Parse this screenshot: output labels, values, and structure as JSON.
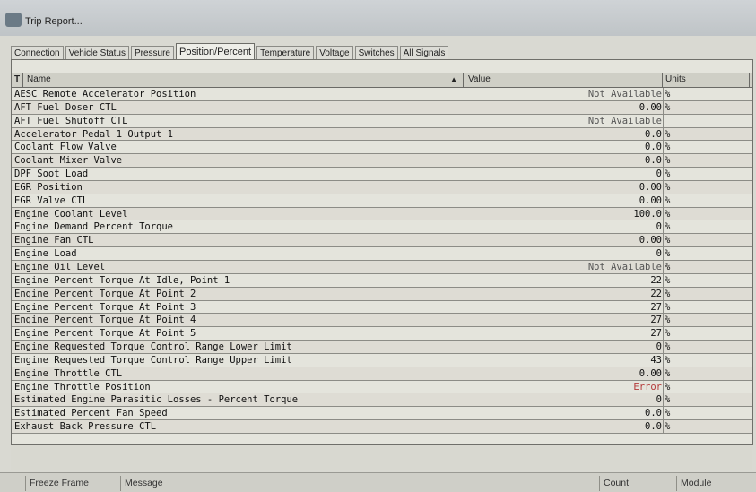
{
  "window": {
    "title": "Trip Report..."
  },
  "tabs": [
    {
      "label": "Connection",
      "active": false
    },
    {
      "label": "Vehicle Status",
      "active": false
    },
    {
      "label": "Pressure",
      "active": false
    },
    {
      "label": "Position/Percent",
      "active": true
    },
    {
      "label": "Temperature",
      "active": false
    },
    {
      "label": "Voltage",
      "active": false
    },
    {
      "label": "Switches",
      "active": false
    },
    {
      "label": "All Signals",
      "active": false
    }
  ],
  "table": {
    "filter_glyph": "T",
    "columns": {
      "name": "Name",
      "sort_glyph": "▲",
      "value": "Value",
      "units": "Units"
    },
    "rows": [
      {
        "name": "AESC Remote Accelerator Position",
        "value": "Not Available",
        "units": "%"
      },
      {
        "name": "AFT Fuel Doser CTL",
        "value": "0.00",
        "units": "%"
      },
      {
        "name": "AFT Fuel Shutoff CTL",
        "value": "Not Available",
        "units": ""
      },
      {
        "name": "Accelerator Pedal 1 Output 1",
        "value": "0.0",
        "units": "%"
      },
      {
        "name": "Coolant Flow Valve",
        "value": "0.0",
        "units": "%"
      },
      {
        "name": "Coolant Mixer Valve",
        "value": "0.0",
        "units": "%"
      },
      {
        "name": "DPF Soot Load",
        "value": "0",
        "units": "%"
      },
      {
        "name": "EGR Position",
        "value": "0.00",
        "units": "%"
      },
      {
        "name": "EGR Valve CTL",
        "value": "0.00",
        "units": "%"
      },
      {
        "name": "Engine Coolant Level",
        "value": "100.0",
        "units": "%"
      },
      {
        "name": "Engine Demand Percent Torque",
        "value": "0",
        "units": "%"
      },
      {
        "name": "Engine Fan CTL",
        "value": "0.00",
        "units": "%"
      },
      {
        "name": "Engine Load",
        "value": "0",
        "units": "%"
      },
      {
        "name": "Engine Oil Level",
        "value": "Not Available",
        "units": "%"
      },
      {
        "name": "Engine Percent Torque At Idle, Point 1",
        "value": "22",
        "units": "%"
      },
      {
        "name": "Engine Percent Torque At Point 2",
        "value": "22",
        "units": "%"
      },
      {
        "name": "Engine Percent Torque At Point 3",
        "value": "27",
        "units": "%"
      },
      {
        "name": "Engine Percent Torque At Point 4",
        "value": "27",
        "units": "%"
      },
      {
        "name": "Engine Percent Torque At Point 5",
        "value": "27",
        "units": "%"
      },
      {
        "name": "Engine Requested Torque Control Range Lower Limit",
        "value": "0",
        "units": "%"
      },
      {
        "name": "Engine Requested Torque Control Range Upper Limit",
        "value": "43",
        "units": "%"
      },
      {
        "name": "Engine Throttle CTL",
        "value": "0.00",
        "units": "%"
      },
      {
        "name": "Engine Throttle Position",
        "value": "Error",
        "units": "%"
      },
      {
        "name": "Estimated Engine Parasitic Losses - Percent Torque",
        "value": "0",
        "units": "%"
      },
      {
        "name": "Estimated Percent Fan Speed",
        "value": "0.0",
        "units": "%"
      },
      {
        "name": "Exhaust Back Pressure CTL",
        "value": "0.0",
        "units": "%"
      }
    ]
  },
  "statusbar": {
    "freeze_frame": "Freeze Frame",
    "message": "Message",
    "count": "Count",
    "module": "Module"
  }
}
